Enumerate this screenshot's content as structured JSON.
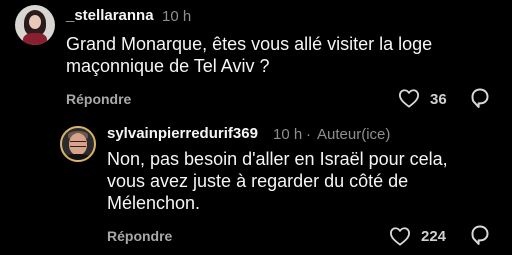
{
  "comments": [
    {
      "username": "_stellaranna",
      "time": "10 h",
      "text": "Grand Monarque, êtes vous allé visiter la loge\nmaçonnique de Tel Aviv ?",
      "reply_label": "Répondre",
      "like_count": "36",
      "like_icon": "heart-icon",
      "share_icon": "share-icon"
    },
    {
      "username": "sylvainpierredurif369",
      "time": "10 h",
      "separator": "·",
      "author_badge": "Auteur(ice)",
      "text": "Non, pas besoin d'aller en Israël pour cela,\nvous avez juste à regarder du côté de\nMélenchon.",
      "reply_label": "Répondre",
      "like_count": "224",
      "like_icon": "heart-icon",
      "share_icon": "share-icon"
    }
  ],
  "colors": {
    "background": "#000000",
    "text": "#f5f5f5",
    "muted": "#8e8e8e",
    "avatar_ring": "#d9b36a"
  }
}
